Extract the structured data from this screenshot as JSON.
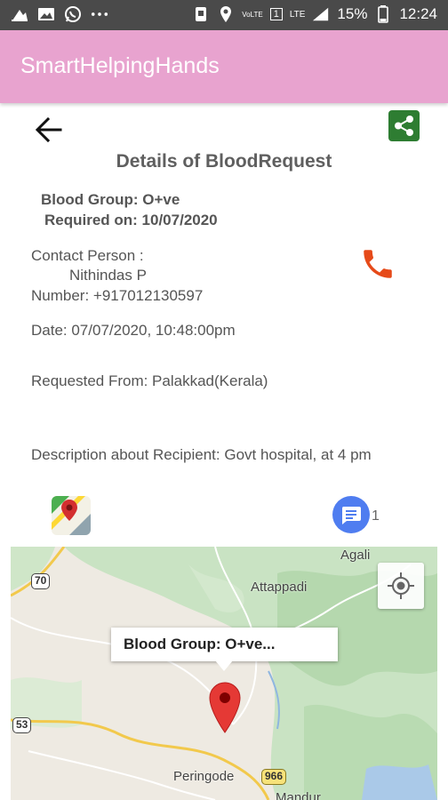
{
  "status_bar": {
    "battery": "15%",
    "time": "12:24",
    "network": "LTE",
    "volte": "VoLTE",
    "sim": "1",
    "icons": [
      "notification-icon",
      "gallery-icon",
      "whatsapp-icon",
      "more-icon",
      "vibrate-icon",
      "location-icon",
      "signal-icon",
      "battery-icon"
    ]
  },
  "app_bar": {
    "title": "SmartHelpingHands"
  },
  "details": {
    "title": "Details of BloodRequest",
    "blood_group": "Blood Group: O+ve",
    "required_on": "Required on: 10/07/2020",
    "contact_label": "Contact Person :",
    "contact_name": "Nithindas P",
    "number": "Number:  +917012130597",
    "date": "Date: 07/07/2020,  10:48:00pm",
    "requested_from": "Requested From: Palakkad(Kerala)",
    "description": "Description about Recipient: Govt hospital, at 4 pm"
  },
  "actions": {
    "comment_count": "1"
  },
  "map": {
    "labels": {
      "agali": "Agali",
      "attappadi": "Attappadi",
      "peringode": "Peringode",
      "mandur": "Mandur"
    },
    "shields": {
      "r70": "70",
      "r53": "53",
      "r966": "966"
    },
    "info_window": "Blood Group: O+ve...",
    "marker_color": "#e53935"
  },
  "colors": {
    "app_bar": "#e8a3cf",
    "share": "#2e7d32",
    "phone": "#e64a19",
    "chat": "#4f7df0"
  }
}
